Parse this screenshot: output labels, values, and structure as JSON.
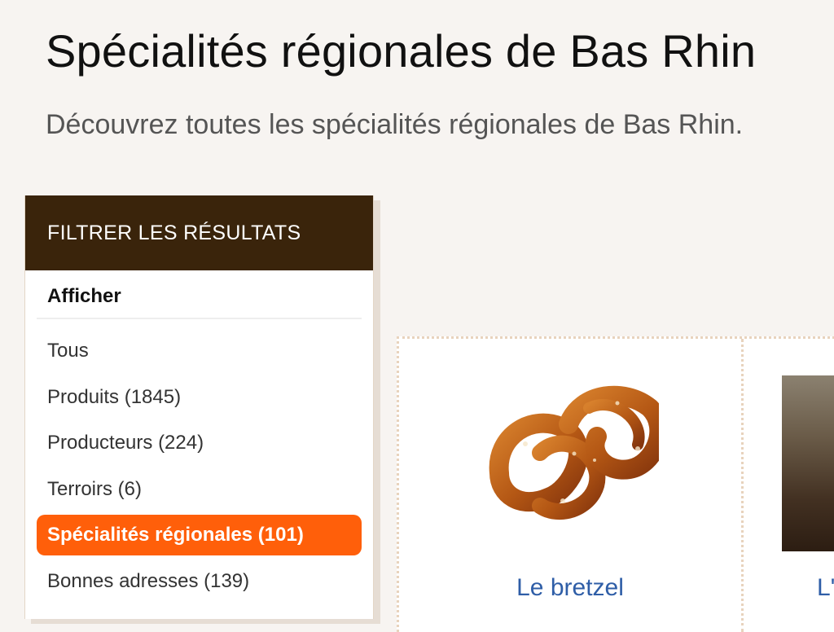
{
  "header": {
    "title": "Spécialités régionales de Bas Rhin",
    "subtitle": "Découvrez toutes les spécialités régionales de Bas Rhin."
  },
  "filter": {
    "header": "FILTRER LES RÉSULTATS",
    "section_title": "Afficher",
    "items": [
      {
        "label": "Tous"
      },
      {
        "label": "Produits (1845)"
      },
      {
        "label": "Producteurs (224)"
      },
      {
        "label": "Terroirs (6)"
      },
      {
        "label": "Spécialités régionales (101)",
        "active": true
      },
      {
        "label": "Bonnes adresses (139)"
      }
    ]
  },
  "results": [
    {
      "title": "Le bretzel",
      "image": "pretzel-image"
    },
    {
      "title": "L'",
      "image": "food-photo"
    }
  ],
  "colors": {
    "background": "#f7f4f1",
    "filter_header_bg": "#3a240b",
    "active_item_bg": "#ff5f0a",
    "link_color": "#2f5ea7",
    "card_border": "#e8d3bd"
  }
}
